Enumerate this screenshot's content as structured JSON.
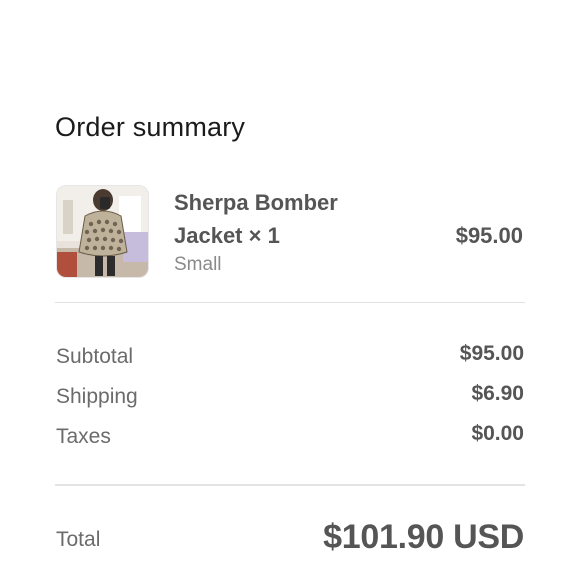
{
  "order_summary": {
    "title": "Order summary"
  },
  "line_item": {
    "name": "Sherpa Bomber\nJacket × 1",
    "variant": "Small",
    "price": "$95.00",
    "image": "product-photo"
  },
  "totals": {
    "rows": [
      {
        "label": "Subtotal",
        "value": "$95.00"
      },
      {
        "label": "Shipping",
        "value": "$6.90"
      },
      {
        "label": "Taxes",
        "value": "$0.00"
      }
    ],
    "total_label": "Total",
    "total_value": "$101.90 USD"
  }
}
